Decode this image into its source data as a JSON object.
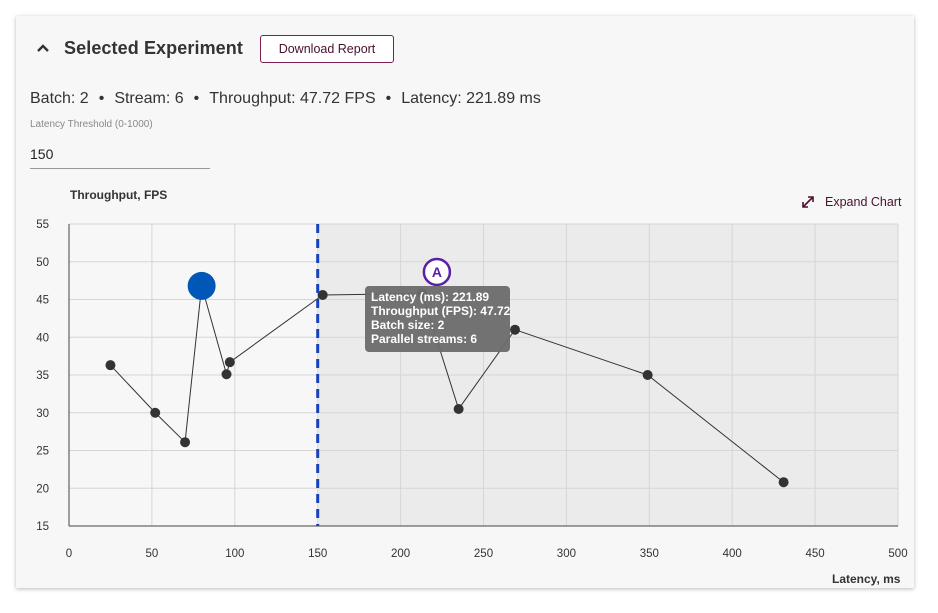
{
  "header": {
    "title": "Selected Experiment",
    "download_label": "Download Report"
  },
  "summary": {
    "batch": "Batch: 2",
    "stream": "Stream: 6",
    "throughput": "Throughput: 47.72 FPS",
    "latency": "Latency: 221.89 ms",
    "separator": "•"
  },
  "threshold": {
    "label": "Latency Threshold (0-1000)",
    "value": "150"
  },
  "chart_actions": {
    "expand_label": "Expand Chart"
  },
  "chart_data": {
    "type": "scatter",
    "ylabel": "Throughput, FPS",
    "xlabel": "Latency, ms",
    "xlim": [
      0,
      500
    ],
    "ylim": [
      15,
      55
    ],
    "xticks": [
      0,
      50,
      100,
      150,
      200,
      250,
      300,
      350,
      400,
      450,
      500
    ],
    "yticks": [
      15,
      20,
      25,
      30,
      35,
      40,
      45,
      50,
      55
    ],
    "grid": true,
    "threshold_x": 150,
    "points": [
      {
        "x": 25,
        "y": 36.3
      },
      {
        "x": 52,
        "y": 30.0
      },
      {
        "x": 70,
        "y": 26.1
      },
      {
        "x": 80,
        "y": 46.8
      },
      {
        "x": 95,
        "y": 35.1
      },
      {
        "x": 97,
        "y": 36.7
      },
      {
        "x": 153,
        "y": 45.6
      },
      {
        "x": 213,
        "y": 45.8
      },
      {
        "x": 235,
        "y": 30.5
      },
      {
        "x": 269,
        "y": 41.0
      },
      {
        "x": 349,
        "y": 35.0
      },
      {
        "x": 431,
        "y": 20.8
      }
    ],
    "highlight_point": {
      "x": 80,
      "y": 46.8
    },
    "selected_point": {
      "x": 221.89,
      "y": 47.72,
      "marker_label": "A"
    },
    "tooltip": [
      "Latency (ms): 221.89",
      "Throughput (FPS): 47.72",
      "Batch size: 2",
      "Parallel streams: 6"
    ],
    "colors": {
      "point": "#333333",
      "line": "#333333",
      "highlight": "#0057b8",
      "threshold": "#1a3fbf",
      "selected": "#5b1fa8",
      "tooltip_bg": "#6b6b6b",
      "shaded_region": "#ebebeb"
    }
  }
}
